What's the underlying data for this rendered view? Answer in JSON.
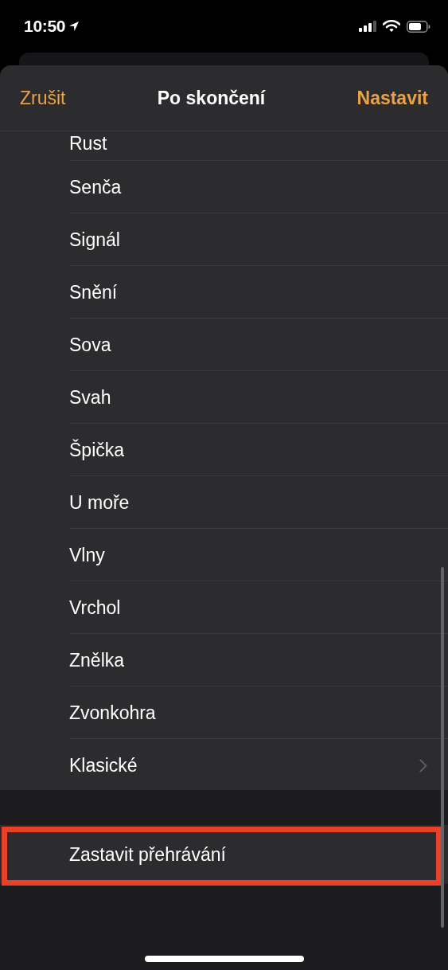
{
  "status_bar": {
    "time": "10:50"
  },
  "header": {
    "cancel": "Zrušit",
    "title": "Po skončení",
    "confirm": "Nastavit"
  },
  "sounds": [
    {
      "label": "Rust",
      "kind": "plain"
    },
    {
      "label": "Senča",
      "kind": "plain"
    },
    {
      "label": "Signál",
      "kind": "plain"
    },
    {
      "label": "Snění",
      "kind": "plain"
    },
    {
      "label": "Sova",
      "kind": "plain"
    },
    {
      "label": "Svah",
      "kind": "plain"
    },
    {
      "label": "Špička",
      "kind": "plain"
    },
    {
      "label": "U moře",
      "kind": "plain"
    },
    {
      "label": "Vlny",
      "kind": "plain"
    },
    {
      "label": "Vrchol",
      "kind": "plain"
    },
    {
      "label": "Znělka",
      "kind": "plain"
    },
    {
      "label": "Zvonkohra",
      "kind": "plain"
    },
    {
      "label": "Klasické",
      "kind": "submenu"
    }
  ],
  "stop_option": {
    "label": "Zastavit přehrávání",
    "highlighted": true
  }
}
